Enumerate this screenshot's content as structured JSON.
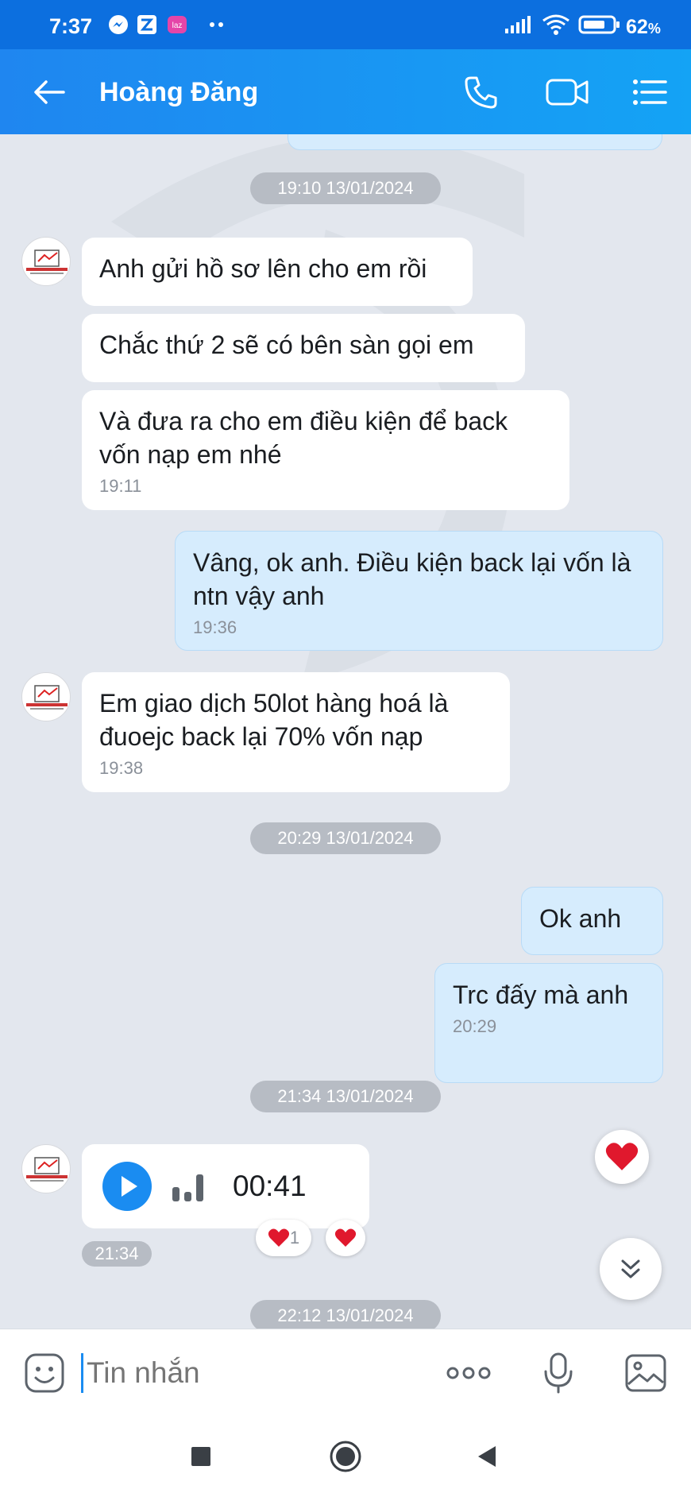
{
  "status_bar": {
    "time": "7:37",
    "battery_percent": "62",
    "battery_unit": "%",
    "notification_icons": [
      "messenger-icon",
      "zalo-icon",
      "lazada-icon",
      "more-dots-icon"
    ],
    "system_icons": [
      "signal-icon",
      "wifi-icon",
      "battery-icon"
    ]
  },
  "header": {
    "title": "Hoàng Đăng",
    "icons": [
      "back-arrow-icon",
      "phone-icon",
      "video-call-icon",
      "menu-list-icon"
    ]
  },
  "chat": {
    "date_separators": [
      "19:10 13/01/2024",
      "20:29 13/01/2024",
      "21:34 13/01/2024",
      "22:12 13/01/2024"
    ],
    "messages": [
      {
        "dir": "in",
        "text": "Anh gửi hồ sơ lên cho em rồi",
        "time": ""
      },
      {
        "dir": "in",
        "text": "Chắc thứ 2 sẽ có bên sàn gọi em",
        "time": ""
      },
      {
        "dir": "in",
        "text": "Và đưa ra cho em điều kiện để back vốn nạp em nhé",
        "time": "19:11"
      },
      {
        "dir": "out",
        "text": "Vâng, ok anh. Điều kiện back lại vốn là ntn vậy anh",
        "time": "19:36"
      },
      {
        "dir": "in",
        "text": "Em giao dịch 50lot hàng hoá là đuoejc back lại 70% vốn nạp",
        "time": "19:38"
      },
      {
        "dir": "out",
        "text": "Ok anh",
        "time": ""
      },
      {
        "dir": "out",
        "text": "Trc đấy mà anh",
        "time": "20:29"
      }
    ],
    "voice": {
      "duration": "00:41",
      "time": "21:34",
      "reaction_count": "1"
    },
    "colors": {
      "accent": "#1a8cf1",
      "outgoing_bubble": "#d6ecfd",
      "background": "#e3e7ee",
      "heart": "#e0182d"
    }
  },
  "composer": {
    "placeholder": "Tin nhắn",
    "icons": [
      "emoji-sticker-icon",
      "more-options-icon",
      "microphone-icon",
      "image-gallery-icon"
    ]
  },
  "nav_bar": {
    "icons": [
      "recent-apps-square-icon",
      "home-circle-icon",
      "back-triangle-icon"
    ]
  }
}
